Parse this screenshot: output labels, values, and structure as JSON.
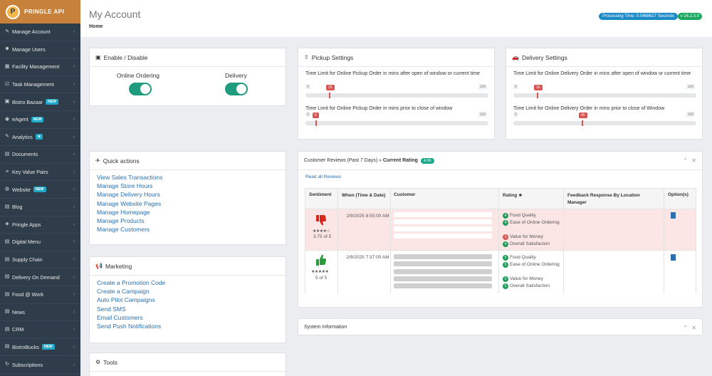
{
  "sidebar": {
    "logo_letter": "P",
    "logo_text": "PRINGLE API",
    "items": [
      {
        "label": "Manage Account",
        "icon": "wrench-icon",
        "badge": ""
      },
      {
        "label": "Manage Users",
        "icon": "users-icon",
        "badge": ""
      },
      {
        "label": "Facility Management",
        "icon": "building-icon",
        "badge": ""
      },
      {
        "label": "Task Management",
        "icon": "tasks-icon",
        "badge": ""
      },
      {
        "label": "Bistro Bazaar",
        "icon": "cart-icon",
        "badge": "NEW"
      },
      {
        "label": "eAgent",
        "icon": "agent-icon",
        "badge": "NEW"
      },
      {
        "label": "Analytics",
        "icon": "analytics-icon",
        "badge": "★"
      },
      {
        "label": "Documents",
        "icon": "document-icon",
        "badge": ""
      },
      {
        "label": "Key Value Pairs",
        "icon": "list-icon",
        "badge": ""
      },
      {
        "label": "Website",
        "icon": "globe-icon",
        "badge": "NEW"
      },
      {
        "label": "Blog",
        "icon": "blog-icon",
        "badge": ""
      },
      {
        "label": "Pringle Apps",
        "icon": "apps-icon",
        "badge": ""
      },
      {
        "label": "Digital Menu",
        "icon": "menu-icon",
        "badge": ""
      },
      {
        "label": "Supply Chain",
        "icon": "chain-icon",
        "badge": ""
      },
      {
        "label": "Delivery On Demand",
        "icon": "delivery-icon",
        "badge": ""
      },
      {
        "label": "Food @ Work",
        "icon": "food-icon",
        "badge": ""
      },
      {
        "label": "News",
        "icon": "news-icon",
        "badge": ""
      },
      {
        "label": "CRM",
        "icon": "crm-icon",
        "badge": ""
      },
      {
        "label": "BistroBucks",
        "icon": "bucks-icon",
        "badge": "NEW"
      },
      {
        "label": "Subscriptions",
        "icon": "refresh-icon",
        "badge": ""
      }
    ]
  },
  "header": {
    "title": "My Account",
    "breadcrumb": "Home",
    "processing": "Processing Time: 0.0468627 Seconds",
    "version": "v 16.2.3.0"
  },
  "enable": {
    "title": "Enable / Disable",
    "online_label": "Online Ordering",
    "delivery_label": "Delivery"
  },
  "pickup": {
    "title": "Pickup Settings",
    "s1_label": "Time Limit for Online Pickup Order in mins after open of window or current time",
    "s1_min": "0",
    "s1_max": "120",
    "s1_val": "15",
    "s1_fraction": 0.125,
    "s2_label": "Time Limit for Online Pickup Order in mins prior to close of window",
    "s2_min": "0",
    "s2_max": "120",
    "s2_val": "5",
    "s2_fraction": 0.0417
  },
  "delivery": {
    "title": "Delivery Settings",
    "s1_label": "Time Limit for Online Delivery Order in mins after open of window or current time",
    "s1_min": "0",
    "s1_max": "120",
    "s1_val": "15",
    "s1_fraction": 0.125,
    "s2_label": "Time Limit for Online Delivery Order in mins prior to close of Window",
    "s2_min": "0",
    "s2_max": "120",
    "s2_val": "45",
    "s2_fraction": 0.375
  },
  "quick": {
    "title": "Quick actions",
    "links": [
      "View Sales Transactions",
      "Manage Store Hours",
      "Manage Delivery Hours",
      "Manage Website Pages",
      "Manage Homepage",
      "Manage Products",
      "Manage Customers"
    ]
  },
  "marketing": {
    "title": "Marketing",
    "links": [
      "Create a Promotion Code",
      "Create a Campaign",
      "Auto Pilot Campaigns",
      "Send SMS",
      "Email Customers",
      "Send Push Notifications"
    ]
  },
  "tools": {
    "title": "Tools"
  },
  "reviews": {
    "title": "Customer Reviews (Past 7 Days) »",
    "current_label": "Current Rating",
    "rating": "4.56",
    "read_all": "Read all Reviews",
    "headers": [
      "Sentiment",
      "When (Time & Date)",
      "Customer",
      "Rating ★",
      "Feedback Response By Location Manager",
      "Option(s)"
    ],
    "rows": [
      {
        "score": "3.75 of 5",
        "when": "2/9/2025 8:55:00 AM",
        "ratings": [
          {
            "n": "4",
            "label": "Food Quality",
            "color": "#1f9b5a"
          },
          {
            "n": "4",
            "label": "Ease of Online Ordering",
            "color": "#1f9b5a"
          },
          {
            "n": "3",
            "label": "Value for Money",
            "color": "#d9534f"
          },
          {
            "n": "4",
            "label": "Overall Satisfaction",
            "color": "#1f9b5a"
          }
        ]
      },
      {
        "score": "5 of 5",
        "when": "2/9/2025 7:37:00 AM",
        "ratings": [
          {
            "n": "5",
            "label": "Food Quality",
            "color": "#1f9b5a"
          },
          {
            "n": "5",
            "label": "Ease of Online Ordering",
            "color": "#1f9b5a"
          },
          {
            "n": "5",
            "label": "Value for Money",
            "color": "#1f9b5a"
          },
          {
            "n": "5",
            "label": "Overall Satisfaction",
            "color": "#1f9b5a"
          }
        ]
      }
    ]
  },
  "system": {
    "title": "System Information"
  }
}
